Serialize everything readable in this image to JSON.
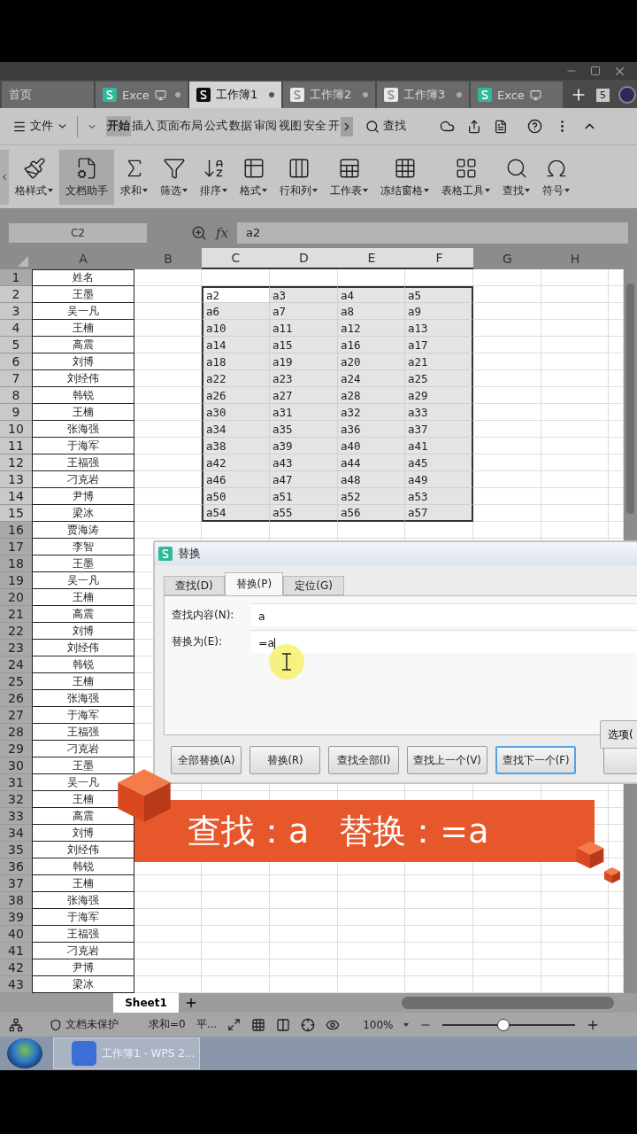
{
  "doc_tabs": [
    {
      "label": "首页",
      "kind": "home",
      "monitor": false,
      "selected": false
    },
    {
      "label": "Exce",
      "kind": "sheet",
      "monitor": true,
      "selected": false
    },
    {
      "label": "工作簿1",
      "kind": "sheet",
      "monitor": false,
      "selected": true
    },
    {
      "label": "工作簿2",
      "kind": "page",
      "monitor": false,
      "selected": false
    },
    {
      "label": "工作簿3",
      "kind": "page",
      "monitor": false,
      "selected": false
    },
    {
      "label": "Exce",
      "kind": "sheet",
      "monitor": true,
      "selected": false
    }
  ],
  "tab_count": "5",
  "menu": {
    "file": "文件",
    "search": "查找",
    "tabs": [
      {
        "label": "开始",
        "selected": true
      },
      {
        "label": "插入",
        "selected": false
      },
      {
        "label": "页面布局",
        "selected": false
      },
      {
        "label": "公式",
        "selected": false
      },
      {
        "label": "数据",
        "selected": false
      },
      {
        "label": "审阅",
        "selected": false
      },
      {
        "label": "视图",
        "selected": false
      },
      {
        "label": "安全",
        "selected": false
      },
      {
        "label": "开",
        "selected": false
      }
    ]
  },
  "ribbon": [
    {
      "label": "格样式",
      "menu": true,
      "selected": false
    },
    {
      "label": "文档助手",
      "menu": false,
      "selected": true
    },
    {
      "label": "求和",
      "menu": true,
      "selected": false
    },
    {
      "label": "筛选",
      "menu": true,
      "selected": false
    },
    {
      "label": "排序",
      "menu": true,
      "selected": false
    },
    {
      "label": "格式",
      "menu": true,
      "selected": false
    },
    {
      "label": "行和列",
      "menu": true,
      "selected": false
    },
    {
      "label": "工作表",
      "menu": true,
      "selected": false
    },
    {
      "label": "冻结窗格",
      "menu": true,
      "selected": false
    },
    {
      "label": "表格工具",
      "menu": true,
      "selected": false
    },
    {
      "label": "查找",
      "menu": true,
      "selected": false
    },
    {
      "label": "符号",
      "menu": true,
      "selected": false
    }
  ],
  "formula_bar": {
    "cell": "C2",
    "fx": "fx",
    "value": "a2"
  },
  "columns": [
    {
      "label": "A",
      "selected": false
    },
    {
      "label": "B",
      "selected": false
    },
    {
      "label": "C",
      "selected": true
    },
    {
      "label": "D",
      "selected": true
    },
    {
      "label": "E",
      "selected": true
    },
    {
      "label": "F",
      "selected": true
    },
    {
      "label": "G",
      "selected": false
    },
    {
      "label": "H",
      "selected": false
    }
  ],
  "rows": [
    {
      "header": "1",
      "selected": false,
      "name": "姓名"
    },
    {
      "header": "2",
      "selected": true,
      "name": "王墨",
      "values": [
        "a2",
        "a3",
        "a4",
        "a5"
      ]
    },
    {
      "header": "3",
      "selected": true,
      "name": "吴一凡",
      "values": [
        "a6",
        "a7",
        "a8",
        "a9"
      ]
    },
    {
      "header": "4",
      "selected": true,
      "name": "王楠",
      "values": [
        "a10",
        "a11",
        "a12",
        "a13"
      ]
    },
    {
      "header": "5",
      "selected": true,
      "name": "高震",
      "values": [
        "a14",
        "a15",
        "a16",
        "a17"
      ]
    },
    {
      "header": "6",
      "selected": true,
      "name": "刘博",
      "values": [
        "a18",
        "a19",
        "a20",
        "a21"
      ]
    },
    {
      "header": "7",
      "selected": true,
      "name": "刘经伟",
      "values": [
        "a22",
        "a23",
        "a24",
        "a25"
      ]
    },
    {
      "header": "8",
      "selected": true,
      "name": "韩锐",
      "values": [
        "a26",
        "a27",
        "a28",
        "a29"
      ]
    },
    {
      "header": "9",
      "selected": true,
      "name": "王楠",
      "values": [
        "a30",
        "a31",
        "a32",
        "a33"
      ]
    },
    {
      "header": "10",
      "selected": true,
      "name": "张海强",
      "values": [
        "a34",
        "a35",
        "a36",
        "a37"
      ]
    },
    {
      "header": "11",
      "selected": true,
      "name": "于海军",
      "values": [
        "a38",
        "a39",
        "a40",
        "a41"
      ]
    },
    {
      "header": "12",
      "selected": true,
      "name": "王福强",
      "values": [
        "a42",
        "a43",
        "a44",
        "a45"
      ]
    },
    {
      "header": "13",
      "selected": true,
      "name": "刁克岩",
      "values": [
        "a46",
        "a47",
        "a48",
        "a49"
      ]
    },
    {
      "header": "14",
      "selected": true,
      "name": "尹博",
      "values": [
        "a50",
        "a51",
        "a52",
        "a53"
      ]
    },
    {
      "header": "15",
      "selected": true,
      "name": "梁冰",
      "values": [
        "a54",
        "a55",
        "a56",
        "a57"
      ]
    },
    {
      "header": "16",
      "selected": false,
      "name": "贾海涛"
    },
    {
      "header": "17",
      "selected": false,
      "name": "李智"
    },
    {
      "header": "18",
      "selected": false,
      "name": "王墨"
    },
    {
      "header": "19",
      "selected": false,
      "name": "吴一凡"
    },
    {
      "header": "20",
      "selected": false,
      "name": "王楠"
    },
    {
      "header": "21",
      "selected": false,
      "name": "高震"
    },
    {
      "header": "22",
      "selected": false,
      "name": "刘博"
    },
    {
      "header": "23",
      "selected": false,
      "name": "刘经伟"
    },
    {
      "header": "24",
      "selected": false,
      "name": "韩锐"
    },
    {
      "header": "25",
      "selected": false,
      "name": "王楠"
    },
    {
      "header": "26",
      "selected": false,
      "name": "张海强"
    },
    {
      "header": "27",
      "selected": false,
      "name": "于海军"
    },
    {
      "header": "28",
      "selected": false,
      "name": "王福强"
    },
    {
      "header": "29",
      "selected": false,
      "name": "刁克岩"
    },
    {
      "header": "30",
      "selected": false,
      "name": "王墨"
    },
    {
      "header": "31",
      "selected": false,
      "name": "吴一凡"
    },
    {
      "header": "32",
      "selected": false,
      "name": "王楠"
    },
    {
      "header": "33",
      "selected": false,
      "name": "高震"
    },
    {
      "header": "34",
      "selected": false,
      "name": "刘博"
    },
    {
      "header": "35",
      "selected": false,
      "name": "刘经伟"
    },
    {
      "header": "36",
      "selected": false,
      "name": "韩锐"
    },
    {
      "header": "37",
      "selected": false,
      "name": "王楠"
    },
    {
      "header": "38",
      "selected": false,
      "name": "张海强"
    },
    {
      "header": "39",
      "selected": false,
      "name": "于海军"
    },
    {
      "header": "40",
      "selected": false,
      "name": "王福强"
    },
    {
      "header": "41",
      "selected": false,
      "name": "刁克岩"
    },
    {
      "header": "42",
      "selected": false,
      "name": "尹博"
    },
    {
      "header": "43",
      "selected": false,
      "name": "梁冰"
    }
  ],
  "sheet_tabs": [
    {
      "label": "Sheet1",
      "selected": true
    }
  ],
  "status_bar": {
    "protect": "文档未保护",
    "sum": "求和=0",
    "avg": "平...",
    "zoom": "100%",
    "zoom_slider": {
      "level": 0.46
    }
  },
  "taskbar": {
    "task": "工作簿1 - WPS 2..."
  },
  "dialog": {
    "title": "替换",
    "tabs": [
      {
        "label": "查找(D)",
        "selected": false
      },
      {
        "label": "替换(P)",
        "selected": true
      },
      {
        "label": "定位(G)",
        "selected": false
      }
    ],
    "fields": [
      {
        "label": "查找内容(N):",
        "value": "a"
      },
      {
        "label": "替换为(E):",
        "value": "=a"
      }
    ],
    "options_button": "选项(",
    "buttons": [
      {
        "label": "全部替换(A)",
        "default": false
      },
      {
        "label": "替换(R)",
        "default": false
      },
      {
        "label": "查找全部(I)",
        "default": false
      },
      {
        "label": "查找上一个(V)",
        "default": false
      },
      {
        "label": "查找下一个(F)",
        "default": true
      }
    ]
  },
  "banner": {
    "parts": [
      "查找：a",
      "替换：=a"
    ]
  }
}
